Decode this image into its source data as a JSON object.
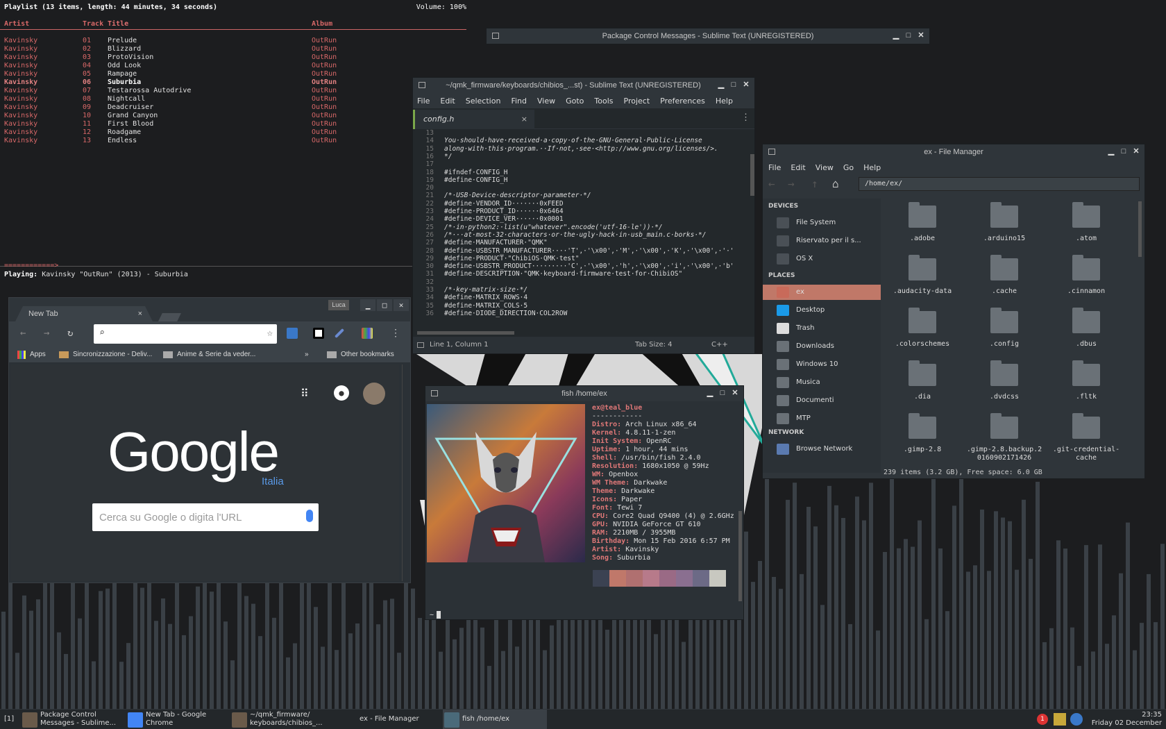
{
  "playlist": {
    "title": "Playlist (13 items, length: 44 minutes, 34 seconds)",
    "volume": "Volume: 100%",
    "headers": {
      "artist": "Artist",
      "track": "Track",
      "title": "Title",
      "album": "Album"
    },
    "rows": [
      {
        "artist": "Kavinsky",
        "track": "01",
        "title": "Prelude",
        "album": "OutRun"
      },
      {
        "artist": "Kavinsky",
        "track": "02",
        "title": "Blizzard",
        "album": "OutRun"
      },
      {
        "artist": "Kavinsky",
        "track": "03",
        "title": "ProtoVision",
        "album": "OutRun"
      },
      {
        "artist": "Kavinsky",
        "track": "04",
        "title": "Odd Look",
        "album": "OutRun"
      },
      {
        "artist": "Kavinsky",
        "track": "05",
        "title": "Rampage",
        "album": "OutRun"
      },
      {
        "artist": "Kavinsky",
        "track": "06",
        "title": "Suburbia",
        "album": "OutRun"
      },
      {
        "artist": "Kavinsky",
        "track": "07",
        "title": "Testarossa Autodrive",
        "album": "OutRun"
      },
      {
        "artist": "Kavinsky",
        "track": "08",
        "title": "Nightcall",
        "album": "OutRun"
      },
      {
        "artist": "Kavinsky",
        "track": "09",
        "title": "Deadcruiser",
        "album": "OutRun"
      },
      {
        "artist": "Kavinsky",
        "track": "10",
        "title": "Grand Canyon",
        "album": "OutRun"
      },
      {
        "artist": "Kavinsky",
        "track": "11",
        "title": "First Blood",
        "album": "OutRun"
      },
      {
        "artist": "Kavinsky",
        "track": "12",
        "title": "Roadgame",
        "album": "OutRun"
      },
      {
        "artist": "Kavinsky",
        "track": "13",
        "title": "Endless",
        "album": "OutRun"
      }
    ],
    "current_index": 5,
    "progress": "============>",
    "playing_label": "Playing:",
    "playing_text": "Kavinsky \"OutRun\" (2013) - Suburbia"
  },
  "package_control": {
    "title": "Package Control Messages - Sublime Text (UNREGISTERED)"
  },
  "sublime": {
    "title": "~/qmk_firmware/keyboards/chibios_...st) - Sublime Text (UNREGISTERED)",
    "menu": [
      "File",
      "Edit",
      "Selection",
      "Find",
      "View",
      "Goto",
      "Tools",
      "Project",
      "Preferences",
      "Help"
    ],
    "tab": "config.h",
    "tab_close": "×",
    "lines": [
      {
        "n": "13",
        "t": "",
        "c": ""
      },
      {
        "n": "14",
        "t": "You·should·have·received·a·copy·of·the·GNU·General·Public·License",
        "c": "cm"
      },
      {
        "n": "15",
        "t": "along·with·this·program.··If·not,·see·<http://www.gnu.org/licenses/>.",
        "c": "cm"
      },
      {
        "n": "16",
        "t": "*/",
        "c": "cm"
      },
      {
        "n": "17",
        "t": "",
        "c": ""
      },
      {
        "n": "18",
        "t": "#ifndef·CONFIG_H",
        "c": ""
      },
      {
        "n": "19",
        "t": "#define·CONFIG_H",
        "c": ""
      },
      {
        "n": "20",
        "t": "",
        "c": ""
      },
      {
        "n": "21",
        "t": "/*·USB·Device·descriptor·parameter·*/",
        "c": "cm"
      },
      {
        "n": "22",
        "t": "#define·VENDOR_ID·······0xFEED",
        "c": ""
      },
      {
        "n": "23",
        "t": "#define·PRODUCT_ID······0x6464",
        "c": ""
      },
      {
        "n": "24",
        "t": "#define·DEVICE_VER······0x0001",
        "c": ""
      },
      {
        "n": "25",
        "t": "/*·in·python2:·list(u\"whatever\".encode('utf-16-le'))·*/",
        "c": "cm"
      },
      {
        "n": "26",
        "t": "/*···at·most·32·characters·or·the·ugly·hack·in·usb_main.c·borks·*/",
        "c": "cm"
      },
      {
        "n": "27",
        "t": "#define·MANUFACTURER·\"QMK\"",
        "c": ""
      },
      {
        "n": "28",
        "t": "#define·USBSTR_MANUFACTURER····'T',·'\\x00',·'M',·'\\x00',·'K',·'\\x00',·'·'",
        "c": ""
      },
      {
        "n": "29",
        "t": "#define·PRODUCT·\"ChibiOS·QMK·test\"",
        "c": ""
      },
      {
        "n": "30",
        "t": "#define·USBSTR_PRODUCT·········'C',·'\\x00',·'h',·'\\x00',·'i',·'\\x00',·'b'",
        "c": ""
      },
      {
        "n": "31",
        "t": "#define·DESCRIPTION·\"QMK·keyboard·firmware·test·for·ChibiOS\"",
        "c": ""
      },
      {
        "n": "32",
        "t": "",
        "c": ""
      },
      {
        "n": "33",
        "t": "/*·key·matrix·size·*/",
        "c": "cm"
      },
      {
        "n": "34",
        "t": "#define·MATRIX_ROWS·4",
        "c": ""
      },
      {
        "n": "35",
        "t": "#define·MATRIX_COLS·5",
        "c": ""
      },
      {
        "n": "36",
        "t": "#define·DIODE_DIRECTION·COL2ROW",
        "c": ""
      }
    ],
    "status_pos": "Line 1, Column 1",
    "status_tab": "Tab Size: 4",
    "status_lang": "C++"
  },
  "file_manager": {
    "title": "ex - File Manager",
    "menu": [
      "File",
      "Edit",
      "View",
      "Go",
      "Help"
    ],
    "location": "/home/ex/",
    "devices_label": "DEVICES",
    "devices": [
      "File System",
      "Riservato per il s...",
      "OS X"
    ],
    "places_label": "PLACES",
    "places": [
      "ex",
      "Desktop",
      "Trash",
      "Downloads",
      "Windows 10",
      "Musica",
      "Documenti",
      "MTP"
    ],
    "network_label": "NETWORK",
    "network": [
      "Browse Network"
    ],
    "files": [
      ".adobe",
      ".arduino15",
      ".atom",
      ".audacity-data",
      ".cache",
      ".cinnamon",
      ".colorschemes",
      ".config",
      ".dbus",
      ".dia",
      ".dvdcss",
      ".fltk",
      ".gimp-2.8",
      ".gimp-2.8.backup.2 0160902171426",
      ".git-credential-cache"
    ],
    "status": "239 items (3.2 GB), Free space: 6.0 GB"
  },
  "terminal": {
    "title": "fish  /home/ex",
    "user": "ex@teal_blue",
    "sep": "------------",
    "info": [
      {
        "k": "Distro:",
        "v": "Arch Linux x86_64"
      },
      {
        "k": "Kernel:",
        "v": "4.8.11-1-zen"
      },
      {
        "k": "Init System:",
        "v": "OpenRC"
      },
      {
        "k": "Uptime:",
        "v": "1 hour, 44 mins"
      },
      {
        "k": "Shell:",
        "v": "/usr/bin/fish 2.4.0"
      },
      {
        "k": "Resolution:",
        "v": "1680x1050 @ 59Hz"
      },
      {
        "k": "WM:",
        "v": "Openbox"
      },
      {
        "k": "WM Theme:",
        "v": "Darkwake"
      },
      {
        "k": "Theme:",
        "v": "Darkwake"
      },
      {
        "k": "Icons:",
        "v": "Paper"
      },
      {
        "k": "Font:",
        "v": "Tewi 7"
      },
      {
        "k": "CPU:",
        "v": "Core2 Quad Q9400 (4) @ 2.6GHz"
      },
      {
        "k": "GPU:",
        "v": "NVIDIA GeForce GT 610"
      },
      {
        "k": "RAM:",
        "v": "2210MB / 3955MB"
      },
      {
        "k": "Birthday:",
        "v": "Mon 15 Feb 2016 6:57 PM"
      },
      {
        "k": "Artist:",
        "v": "Kavinsky"
      },
      {
        "k": "Song:",
        "v": "Suburbia"
      }
    ],
    "palette": [
      "#3b4252",
      "#c0786a",
      "#b07070",
      "#b77a8a",
      "#9a6a85",
      "#8a6f90",
      "#6c6a86",
      "#c8c8c0"
    ],
    "prompt": "~"
  },
  "chrome": {
    "user": "Luca",
    "tab": "New Tab",
    "tab_close": "×",
    "bookmarks": [
      "Apps",
      "Sincronizzazione - Deliv...",
      "Anime & Serie da veder...",
      "Other bookmarks"
    ],
    "bm_more": "»",
    "logo": "Google",
    "logo_sub": "Italia",
    "search_placeholder": "Cerca su Google o digita l'URL"
  },
  "taskbar": {
    "workspace": "[1]",
    "items": [
      {
        "l1": "Package Control",
        "l2": "Messages - Sublime..."
      },
      {
        "l1": "New Tab - Google",
        "l2": "Chrome"
      },
      {
        "l1": "~/qmk_firmware/",
        "l2": "keyboards/chibios_..."
      },
      {
        "l1": "ex - File Manager",
        "l2": ""
      },
      {
        "l1": "fish  /home/ex",
        "l2": ""
      }
    ],
    "notif_count": "1",
    "time": "23:35",
    "date": "Friday 02 December"
  }
}
